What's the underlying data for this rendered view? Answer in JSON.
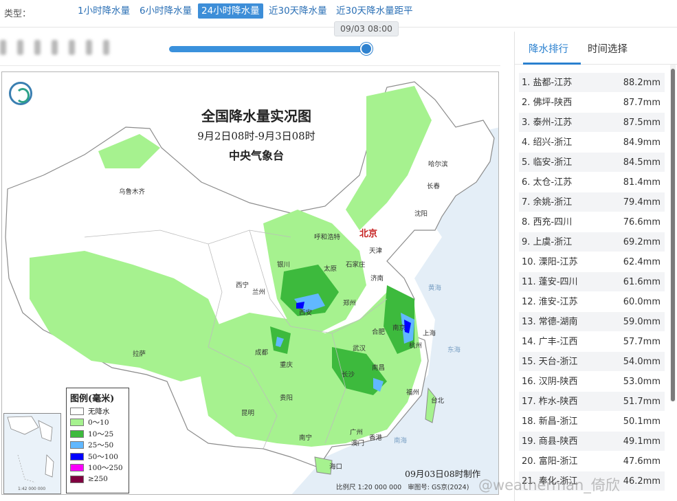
{
  "typebar": {
    "label": "类型：",
    "tabs": [
      {
        "label": "1小时降水量",
        "active": false
      },
      {
        "label": "6小时降水量",
        "active": false
      },
      {
        "label": "24小时降水量",
        "active": true
      },
      {
        "label": "近30天降水量",
        "active": false
      },
      {
        "label": "近30天降水量距平",
        "active": false
      }
    ]
  },
  "timeline": {
    "tooltip": "09/03 08:00",
    "progress": 1.0
  },
  "map": {
    "title": "全国降水量实况图",
    "subtitle": "9月2日08时-9月3日08时",
    "org": "中央气象台",
    "capital": "北京",
    "cities": [
      "乌鲁木齐",
      "哈尔滨",
      "长春",
      "沈阳",
      "呼和浩特",
      "天津",
      "石家庄",
      "太原",
      "银川",
      "济南",
      "西宁",
      "兰州",
      "西安",
      "郑州",
      "合肥",
      "南京",
      "上海",
      "杭州",
      "武汉",
      "成都",
      "重庆",
      "拉萨",
      "长沙",
      "南昌",
      "福州",
      "台北",
      "贵阳",
      "昆明",
      "南宁",
      "广州",
      "香港",
      "澳门",
      "海口"
    ],
    "seas": [
      "黄海",
      "东海",
      "南海"
    ],
    "legend": {
      "title": "图例(毫米)",
      "items": [
        {
          "label": "无降水",
          "color": "#ffffff"
        },
        {
          "label": "0～10",
          "color": "#a6f28f"
        },
        {
          "label": "10～25",
          "color": "#3dba3d"
        },
        {
          "label": "25～50",
          "color": "#61b8ff"
        },
        {
          "label": "50～100",
          "color": "#0000ff"
        },
        {
          "label": "100～250",
          "color": "#fa00fa"
        },
        {
          "label": "≥250",
          "color": "#800040"
        }
      ]
    },
    "made_time": "09月03日08时制作",
    "scale": "比例尺 1:20 000 000",
    "review_no": "审图号: GS京(2024)",
    "inset_caption": "1:42 000 000"
  },
  "side": {
    "tabs": [
      {
        "label": "降水排行",
        "active": true
      },
      {
        "label": "时间选择",
        "active": false
      }
    ],
    "ranking": [
      {
        "name": "1. 盐都-江苏",
        "value": "88.2mm"
      },
      {
        "name": "2. 佛坪-陕西",
        "value": "87.7mm"
      },
      {
        "name": "3. 泰州-江苏",
        "value": "87.5mm"
      },
      {
        "name": "4. 绍兴-浙江",
        "value": "84.9mm"
      },
      {
        "name": "5. 临安-浙江",
        "value": "84.5mm"
      },
      {
        "name": "6. 太仓-江苏",
        "value": "81.4mm"
      },
      {
        "name": "7. 余姚-浙江",
        "value": "79.4mm"
      },
      {
        "name": "8. 西充-四川",
        "value": "76.6mm"
      },
      {
        "name": "9. 上虞-浙江",
        "value": "69.2mm"
      },
      {
        "name": "10. 溧阳-江苏",
        "value": "62.4mm"
      },
      {
        "name": "11. 蓬安-四川",
        "value": "61.6mm"
      },
      {
        "name": "12. 淮安-江苏",
        "value": "60.0mm"
      },
      {
        "name": "13. 常德-湖南",
        "value": "59.0mm"
      },
      {
        "name": "14. 广丰-江西",
        "value": "57.7mm"
      },
      {
        "name": "15. 天台-浙江",
        "value": "54.0mm"
      },
      {
        "name": "16. 汉阴-陕西",
        "value": "53.0mm"
      },
      {
        "name": "17. 柞水-陕西",
        "value": "51.7mm"
      },
      {
        "name": "18. 新昌-浙江",
        "value": "50.1mm"
      },
      {
        "name": "19. 商县-陕西",
        "value": "49.1mm"
      },
      {
        "name": "20. 富阳-浙江",
        "value": "47.6mm"
      },
      {
        "name": "21. 奉化-浙江",
        "value": "46.2mm"
      }
    ]
  },
  "watermark": "@weatherman_倚欣"
}
